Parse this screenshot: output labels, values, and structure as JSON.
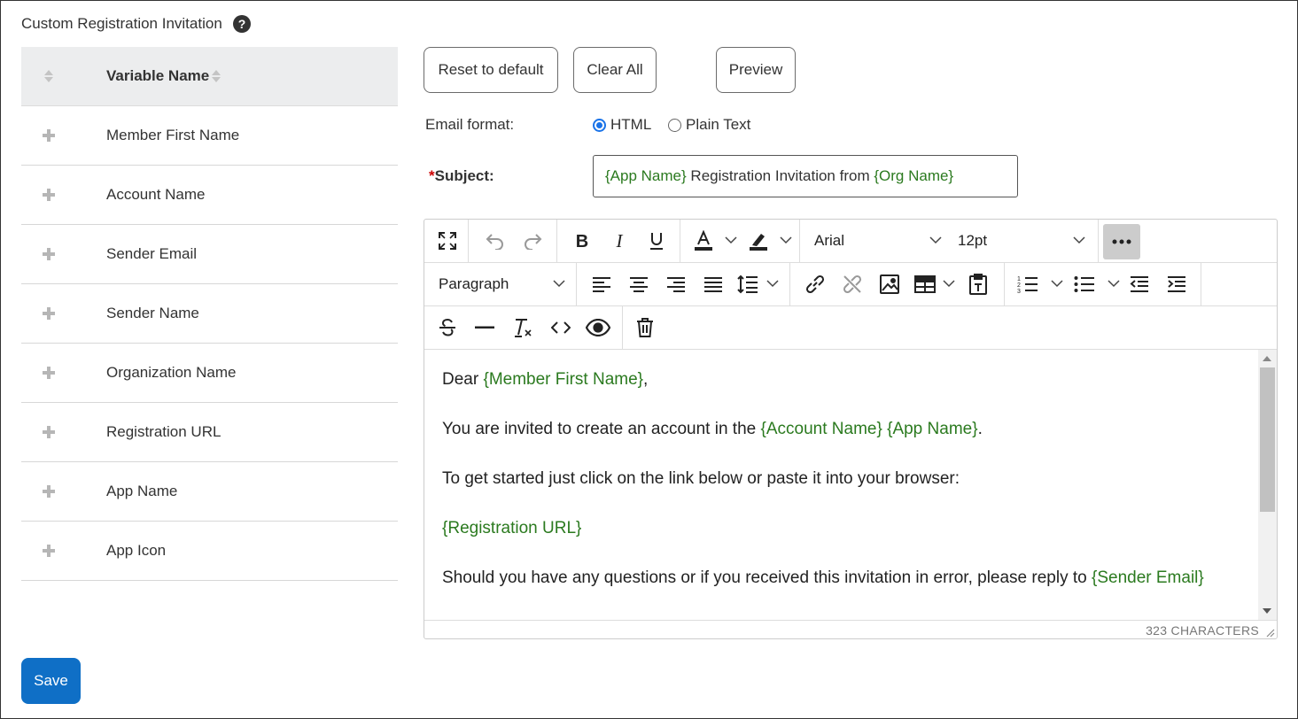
{
  "section": {
    "title": "Custom Registration Invitation",
    "help_icon": "question-circle-icon"
  },
  "variables": {
    "column_header": "Variable Name",
    "rows": [
      {
        "label": "Member First Name"
      },
      {
        "label": "Account Name"
      },
      {
        "label": "Sender Email"
      },
      {
        "label": "Sender Name"
      },
      {
        "label": "Organization Name"
      },
      {
        "label": "Registration URL"
      },
      {
        "label": "App Name"
      },
      {
        "label": "App Icon"
      }
    ]
  },
  "actions": {
    "reset": "Reset to default",
    "clear": "Clear All",
    "preview": "Preview"
  },
  "email_format": {
    "label": "Email format:",
    "options": [
      {
        "label": "HTML",
        "selected": true
      },
      {
        "label": "Plain Text",
        "selected": false
      }
    ]
  },
  "subject": {
    "required_mark": "*",
    "label": "Subject:",
    "parts": [
      {
        "text": "{App Name}",
        "var": true
      },
      {
        "text": " Registration Invitation from ",
        "var": false
      },
      {
        "text": "{Org Name}",
        "var": true
      }
    ]
  },
  "toolbar": {
    "font_family": "Arial",
    "font_size": "12pt",
    "block_format": "Paragraph"
  },
  "body": {
    "paragraphs": [
      [
        {
          "text": "Dear ",
          "var": false
        },
        {
          "text": "{Member First Name}",
          "var": true
        },
        {
          "text": ",",
          "var": false
        }
      ],
      [
        {
          "text": "You are invited to create an account in the ",
          "var": false
        },
        {
          "text": "{Account Name}",
          "var": true
        },
        {
          "text": " ",
          "var": false
        },
        {
          "text": "{App Name}",
          "var": true
        },
        {
          "text": ".",
          "var": false
        }
      ],
      [
        {
          "text": "To get started just click on the link below or paste it into your browser:",
          "var": false
        }
      ],
      [
        {
          "text": "{Registration URL}",
          "var": true
        }
      ],
      [
        {
          "text": "Should you have any questions or if you received this invitation in error, please reply to ",
          "var": false
        },
        {
          "text": "{Sender Email}",
          "var": true
        }
      ]
    ]
  },
  "status": {
    "char_count": "323 CHARACTERS"
  },
  "save_label": "Save",
  "colors": {
    "variable": "#2b7a1f",
    "primary": "#0f6fc6",
    "required": "#cc0000"
  }
}
